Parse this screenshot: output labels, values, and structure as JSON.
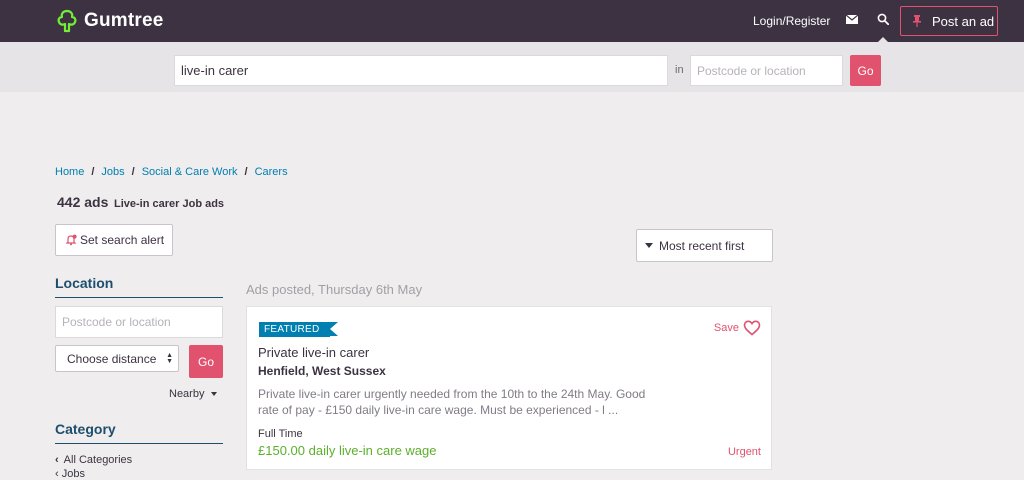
{
  "header": {
    "logo_text": "Gumtree",
    "login_label": "Login/Register",
    "post_ad_label": "Post an ad"
  },
  "search": {
    "query_value": "live-in carer",
    "in_label": "in",
    "location_placeholder": "Postcode or location",
    "go_label": "Go"
  },
  "breadcrumb": [
    "Home",
    "Jobs",
    "Social & Care Work",
    "Carers"
  ],
  "results": {
    "count": "442 ads",
    "description": "Live-in carer Job ads",
    "alert_label": "Set search alert",
    "sort_label": "Most recent first"
  },
  "sidebar": {
    "location_heading": "Location",
    "postcode_placeholder": "Postcode or location",
    "distance_label": "Choose distance",
    "go_label": "Go",
    "nearby_label": "Nearby",
    "category_heading": "Category",
    "all_categories_label": "All Categories",
    "jobs_label": "Jobs"
  },
  "listing": {
    "posted_label": "Ads posted, Thursday 6th May",
    "badge": "FEATURED",
    "save_label": "Save",
    "title": "Private live-in carer",
    "location": "Henfield, West Sussex",
    "description": "Private live-in carer urgently needed from the 10th to the 24th May. Good rate of pay - £150 daily live-in care wage. Must be experienced - l ...",
    "job_type": "Full Time",
    "wage": "£150.00 daily live-in care wage",
    "urgency": "Urgent"
  },
  "colors": {
    "header_bg": "#3c3241",
    "accent": "#e0526e",
    "link": "#007fb0",
    "logo_green": "#72ef36",
    "wage_green": "#5cb02c"
  },
  "icons": [
    "tree-logo-icon",
    "mail-icon",
    "search-icon",
    "pin-icon",
    "bell-alert-icon",
    "heart-icon"
  ]
}
